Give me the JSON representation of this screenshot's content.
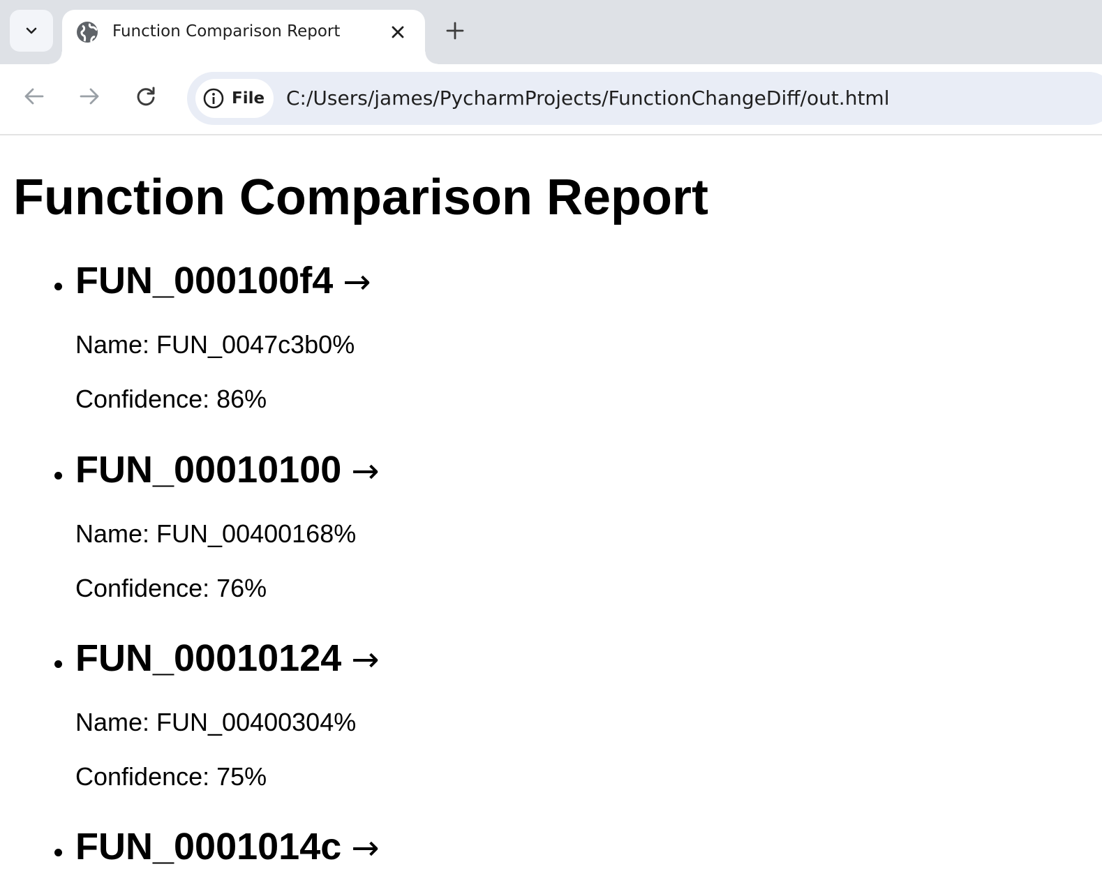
{
  "browser": {
    "tab_title": "Function Comparison Report",
    "site_chip_label": "File",
    "url": "C:/Users/james/PycharmProjects/FunctionChangeDiff/out.html"
  },
  "page": {
    "title": "Function Comparison Report",
    "arrow": "→",
    "name_prefix": "Name: ",
    "confidence_prefix": "Confidence: ",
    "functions": [
      {
        "id": "FUN_000100f4",
        "name": "FUN_0047c3b0%",
        "confidence": "86%"
      },
      {
        "id": "FUN_00010100",
        "name": "FUN_00400168%",
        "confidence": "76%"
      },
      {
        "id": "FUN_00010124",
        "name": "FUN_00400304%",
        "confidence": "75%"
      },
      {
        "id": "FUN_0001014c"
      }
    ]
  }
}
